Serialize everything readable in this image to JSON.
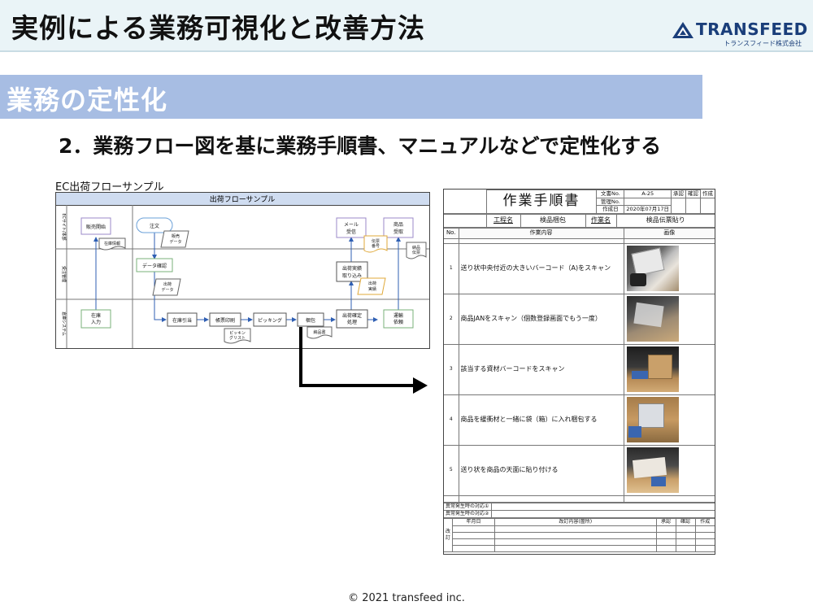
{
  "header": {
    "title": "実例による業務可視化と改善方法",
    "logo_text": "TRANSFEED",
    "logo_sub": "トランスフィード株式会社"
  },
  "section": {
    "title": "業務の定性化",
    "subtitle": "2．業務フロー図を基に業務手順書、マニュアルなどで定性化する"
  },
  "flow": {
    "label": "EC出荷フローサンプル",
    "title": "出荷フローサンプル",
    "lanes": [
      "ECサイト/本部",
      "受注管理",
      "倉庫システム"
    ],
    "nodes": {
      "sales_start": "販売開始",
      "order": "注文",
      "data_check": "データ確認",
      "stock_alloc": "在庫引当",
      "slip_print": "帳票印刷",
      "picking": "ピッキング",
      "packing": "梱包",
      "ship_confirm_1": "出荷確定",
      "ship_confirm_2": "処理",
      "carrier_1": "運輸",
      "carrier_2": "依頼",
      "stock_in_1": "在庫",
      "stock_in_2": "入力",
      "mail_1": "メール",
      "mail_2": "受信",
      "product_recv_1": "商品",
      "product_recv_2": "受取",
      "ship_result_1": "出荷実績",
      "ship_result_2": "取り込み"
    },
    "docs": {
      "stock_info": "在庫情報",
      "sales_data_1": "販売",
      "sales_data_2": "データ",
      "ship_data_1": "出荷",
      "ship_data_2": "データ",
      "picking_list_1": "ピッキン",
      "picking_list_2": "グリスト",
      "delivery_note": "納品書",
      "slip_no_1": "伝票",
      "slip_no_2": "番号",
      "ship_result_doc_1": "出荷",
      "ship_result_doc_2": "実績",
      "delivery_slip_1": "納品",
      "delivery_slip_2": "伝票"
    }
  },
  "doc": {
    "title": "作業手順書",
    "doc_no_label": "文書No.",
    "doc_no": "A-25",
    "mgmt_no_label": "管理No.",
    "created_label": "作成日",
    "created": "2020年07月17日",
    "approval": "承認",
    "confirm": "確認",
    "author": "作成",
    "process_label": "工程名",
    "process": "検品梱包",
    "task_label": "作業名",
    "task": "検品伝票貼り",
    "col_no": "No.",
    "col_content": "作業内容",
    "col_image": "画像",
    "steps": [
      {
        "no": "1",
        "text": "送り状中央付近の大きいバーコード（A)をスキャン"
      },
      {
        "no": "2",
        "text": "商品JANをスキャン（個数登録画面でもう一度）"
      },
      {
        "no": "3",
        "text": "該当する資材バーコードをスキャン"
      },
      {
        "no": "4",
        "text": "商品を緩衝材と一緒に袋（箱）に入れ梱包する"
      },
      {
        "no": "5",
        "text": "送り状を商品の天面に貼り付ける"
      }
    ],
    "abnormal_1": "異常発生時の対応①",
    "abnormal_2": "異常発生時の対応②",
    "rev_label_1": "改",
    "rev_label_2": "訂",
    "rev_date": "年月日",
    "rev_content": "改訂内容(箇所)",
    "rev_approval": "承認",
    "rev_confirm": "確認",
    "rev_author": "作成"
  },
  "footer": {
    "copyright": "© 2021 transfeed inc."
  }
}
